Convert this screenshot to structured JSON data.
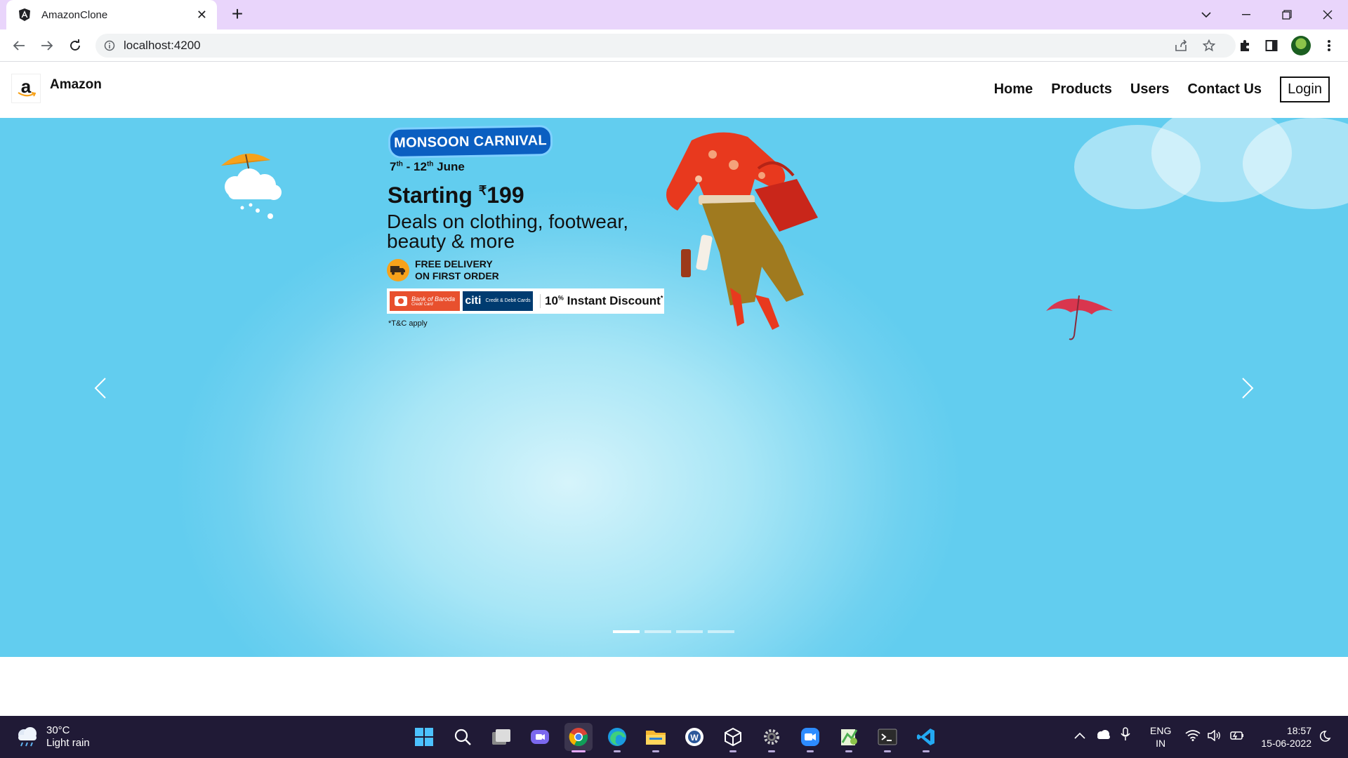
{
  "browser": {
    "tab_title": "AmazonClone",
    "url": "localhost:4200"
  },
  "navbar": {
    "brand_letter": "a",
    "brand_name": "Amazon",
    "links": [
      "Home",
      "Products",
      "Users",
      "Contact Us"
    ],
    "login_label": "Login"
  },
  "hero": {
    "badge": "MONSOON CARNIVAL",
    "date_start_day": "7",
    "date_start_suffix": "th",
    "date_end_day": "12",
    "date_end_suffix": "th",
    "date_month": "June",
    "starting_label": "Starting",
    "currency_symbol": "₹",
    "price": "199",
    "deals_line": "Deals on clothing, footwear, beauty & more",
    "delivery_line1": "FREE DELIVERY",
    "delivery_line2": "ON FIRST ORDER",
    "bank1": "Bank of Baroda",
    "bank1_sub": "Credit Card",
    "bank2": "citi",
    "bank2_sub": "Credit & Debit Cards",
    "discount_value": "10",
    "discount_unit": "%",
    "discount_label": "Instant Discount",
    "discount_mark": "*",
    "tnc": "*T&C apply",
    "slide_count": 4,
    "active_slide": 1
  },
  "taskbar": {
    "temperature": "30°C",
    "weather": "Light rain",
    "lang_line1": "ENG",
    "lang_line2": "IN",
    "time": "18:57",
    "date": "15-06-2022"
  },
  "colors": {
    "tabstrip": "#e9d5fb",
    "hero_sky": "#62cdef",
    "badge_blue": "#0b5fc1",
    "taskbar": "#201a36"
  }
}
